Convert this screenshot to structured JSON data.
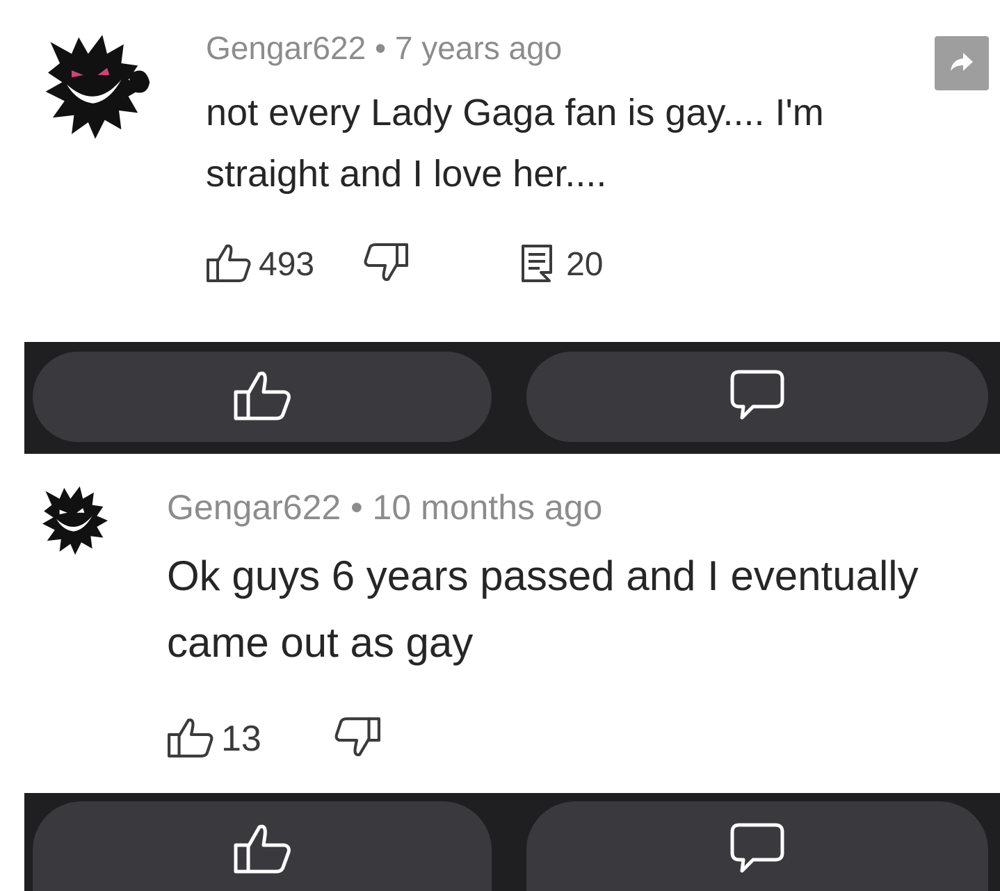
{
  "comments": [
    {
      "author": "Gengar622",
      "separator": "•",
      "time": "7 years ago",
      "text": "not every Lady Gaga fan is gay.... I'm straight and I love her....",
      "likes": "493",
      "replies": "20",
      "avatar_icon": "gengar-avatar-icon"
    },
    {
      "author": "Gengar622",
      "separator": "•",
      "time": "10 months ago",
      "text": "Ok guys 6 years passed and I eventually came out as gay",
      "likes": "13",
      "avatar_icon": "gengar-avatar-icon"
    }
  ],
  "icons": {
    "like": "thumbs-up-icon",
    "dislike": "thumbs-down-icon",
    "reply": "reply-icon",
    "share": "share-arrow-icon",
    "comment": "speech-bubble-icon"
  },
  "colors": {
    "bar_background": "#1f1f22",
    "pill_background": "#3a3a3e",
    "meta_text": "#8c8c8c",
    "body_text": "#262626",
    "share_button": "#9e9e9e"
  }
}
